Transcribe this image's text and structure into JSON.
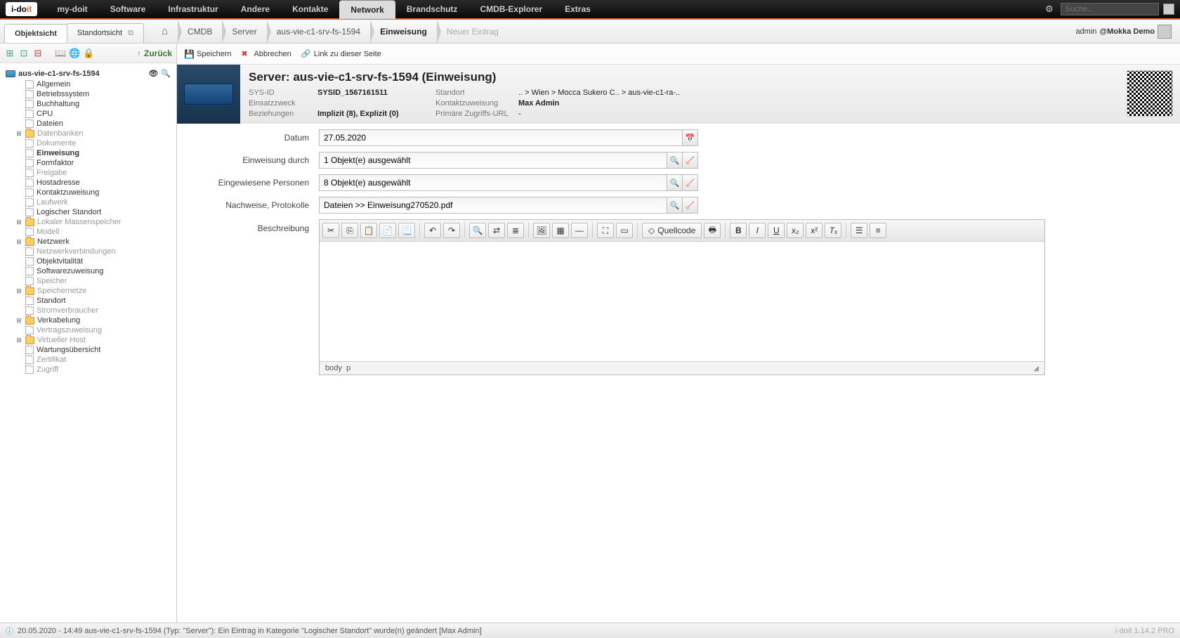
{
  "top": {
    "menu": [
      "my-doit",
      "Software",
      "Infrastruktur",
      "Andere",
      "Kontakte",
      "Network",
      "Brandschutz",
      "CMDB-Explorer",
      "Extras"
    ],
    "active": "Network",
    "search_placeholder": "Suche.."
  },
  "tabs": {
    "obj": "Objektsicht",
    "loc": "Standortsicht"
  },
  "breadcrumbs": [
    "CMDB",
    "Server",
    "aus-vie-c1-srv-fs-1594",
    "Einweisung",
    "Neuer Eintrag"
  ],
  "user": {
    "name": "admin",
    "tenant": "@Mokka Demo"
  },
  "sidebar": {
    "back": "Zurück",
    "root": "aus-vie-c1-srv-fs-1594",
    "items": [
      {
        "label": "Allgemein",
        "type": "page"
      },
      {
        "label": "Betriebssystem",
        "type": "page"
      },
      {
        "label": "Buchhaltung",
        "type": "page"
      },
      {
        "label": "CPU",
        "type": "page"
      },
      {
        "label": "Dateien",
        "type": "page"
      },
      {
        "label": "Datenbanken",
        "type": "folder",
        "exp": true,
        "muted": true
      },
      {
        "label": "Dokumente",
        "type": "page",
        "muted": true
      },
      {
        "label": "Einweisung",
        "type": "page",
        "sel": true
      },
      {
        "label": "Formfaktor",
        "type": "page"
      },
      {
        "label": "Freigabe",
        "type": "page",
        "muted": true
      },
      {
        "label": "Hostadresse",
        "type": "page"
      },
      {
        "label": "Kontaktzuweisung",
        "type": "page"
      },
      {
        "label": "Laufwerk",
        "type": "page",
        "muted": true
      },
      {
        "label": "Logischer Standort",
        "type": "page"
      },
      {
        "label": "Lokaler Massenspeicher",
        "type": "folder",
        "exp": true,
        "muted": true
      },
      {
        "label": "Modell",
        "type": "page",
        "muted": true
      },
      {
        "label": "Netzwerk",
        "type": "folder",
        "exp": true
      },
      {
        "label": "Netzwerkverbindungen",
        "type": "page",
        "muted": true
      },
      {
        "label": "Objektvitalität",
        "type": "page"
      },
      {
        "label": "Softwarezuweisung",
        "type": "page"
      },
      {
        "label": "Speicher",
        "type": "page",
        "muted": true
      },
      {
        "label": "Speichernetze",
        "type": "folder",
        "exp": true,
        "muted": true
      },
      {
        "label": "Standort",
        "type": "page"
      },
      {
        "label": "Stromverbraucher",
        "type": "page",
        "muted": true
      },
      {
        "label": "Verkabelung",
        "type": "folder",
        "exp": true
      },
      {
        "label": "Vertragszuweisung",
        "type": "page",
        "muted": true
      },
      {
        "label": "Virtueller Host",
        "type": "folder",
        "exp": true,
        "muted": true
      },
      {
        "label": "Wartungsübersicht",
        "type": "page"
      },
      {
        "label": "Zertifikat",
        "type": "page",
        "muted": true
      },
      {
        "label": "Zugriff",
        "type": "page",
        "muted": true
      }
    ]
  },
  "actions": {
    "save": "Speichern",
    "cancel": "Abbrechen",
    "link": "Link zu dieser Seite"
  },
  "header": {
    "title": "Server: aus-vie-c1-srv-fs-1594 (Einweisung)",
    "k_sysid": "SYS-ID",
    "v_sysid": "SYSID_1567161511",
    "k_standort": "Standort",
    "v_standort": ".. > Wien > Mocca Sukero C.. > aus-vie-c1-ra-..",
    "k_einsatz": "Einsatzzweck",
    "v_einsatz": "",
    "k_kontakt": "Kontaktzuweisung",
    "v_kontakt": "Max Admin",
    "k_bez": "Beziehungen",
    "v_bez": "Implizit (8), Explizit (0)",
    "k_url": "Primäre Zugriffs-URL",
    "v_url": "-"
  },
  "form": {
    "l_datum": "Datum",
    "v_datum": "27.05.2020",
    "l_durch": "Einweisung durch",
    "v_durch": "1 Objekt(e) ausgewählt",
    "l_pers": "Eingewiesene Personen",
    "v_pers": "8 Objekt(e) ausgewählt",
    "l_nach": "Nachweise, Protokolle",
    "v_nach": "Dateien >> Einweisung270520.pdf",
    "l_besch": "Beschreibung"
  },
  "rte": {
    "source": "Quellcode",
    "path1": "body",
    "path2": "p"
  },
  "status": {
    "msg": "20.05.2020 - 14:49 aus-vie-c1-srv-fs-1594 (Typ: \"Server\"): Ein Eintrag in Kategorie \"Logischer Standort\" wurde(n) geändert [Max Admin]",
    "ver": "i-doit 1.14.2 PRO"
  }
}
